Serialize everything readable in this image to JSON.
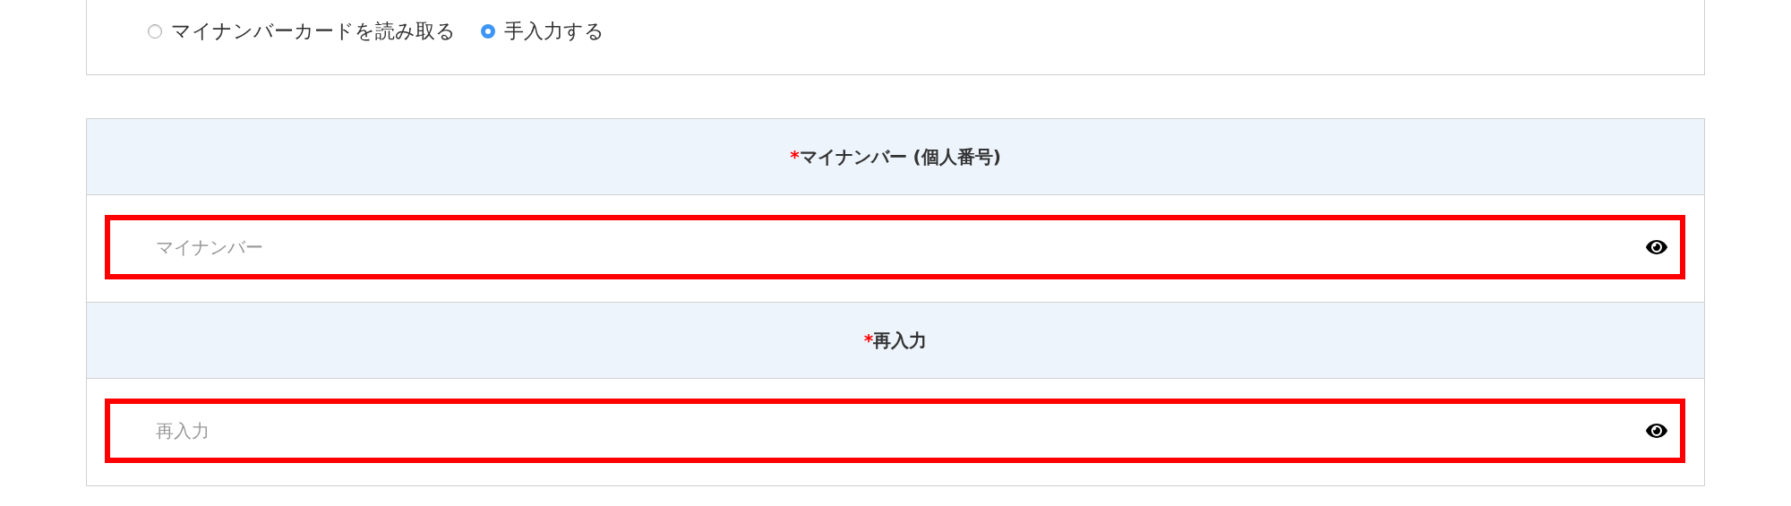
{
  "read_method": {
    "options": [
      {
        "label": "マイナンバーカードを読み取る",
        "selected": false
      },
      {
        "label": "手入力する",
        "selected": true
      }
    ]
  },
  "fields": [
    {
      "required_mark": "*",
      "label": "マイナンバー (個人番号)",
      "placeholder": "マイナンバー",
      "highlighted": true
    },
    {
      "required_mark": "*",
      "label": "再入力",
      "placeholder": "再入力",
      "highlighted": true
    }
  ]
}
